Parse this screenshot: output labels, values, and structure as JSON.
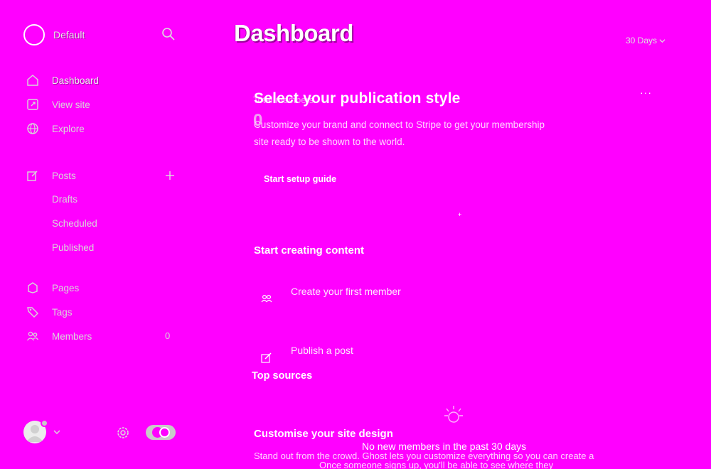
{
  "brand": {
    "name": "Default"
  },
  "nav": {
    "primary": [
      {
        "label": "Dashboard",
        "icon": "home-icon"
      },
      {
        "label": "View site",
        "icon": "external-icon"
      },
      {
        "label": "Explore",
        "icon": "globe-icon"
      }
    ],
    "posts": {
      "label": "Posts",
      "icon": "edit-icon"
    },
    "posts_sub": [
      "Drafts",
      "Scheduled",
      "Published"
    ],
    "secondary": [
      {
        "label": "Pages",
        "icon": "page-icon"
      },
      {
        "label": "Tags",
        "icon": "tag-icon"
      },
      {
        "label": "Members",
        "icon": "members-icon",
        "count": "0"
      }
    ]
  },
  "main": {
    "title": "Dashboard",
    "range": "30 Days",
    "background_stat": {
      "label": "Total members",
      "value": "0"
    },
    "setup": {
      "title": "Select your publication style",
      "description": "Customize your brand and connect to Stripe to get your membership site ready to be shown to the world.",
      "more": "···",
      "button": "Start setup guide",
      "dot": "+"
    },
    "create_section": {
      "title": "Start creating content",
      "tasks": [
        {
          "label": "Create your first member",
          "icon": "member-icon"
        },
        {
          "label": "Publish a post",
          "icon": "pencil-icon"
        }
      ]
    },
    "top_sources": {
      "title": "Top sources",
      "empty_title": "No new members in the past 30 days",
      "empty_desc": "Once someone signs up, you'll be able to see where they"
    },
    "customise": {
      "title": "Customise your site design",
      "description": "Stand out from the crowd. Ghost lets you customize everything so you can create a"
    }
  },
  "colors": {
    "background": "#ff00ff",
    "text": "#ffffff",
    "muted": "#ffd6ff"
  }
}
